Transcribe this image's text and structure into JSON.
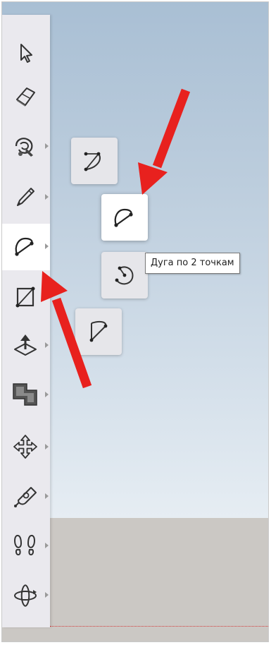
{
  "tooltip": {
    "text": "Дуга по 2 точкам"
  },
  "toolbar": {
    "tools": [
      {
        "name": "select-tool",
        "icon": "arrow-cursor-icon",
        "has_submenu": false
      },
      {
        "name": "eraser-tool",
        "icon": "eraser-icon",
        "has_submenu": false
      },
      {
        "name": "paint-bucket-tool",
        "icon": "paint-bucket-icon",
        "has_submenu": true
      },
      {
        "name": "line-tool",
        "icon": "pencil-icon",
        "has_submenu": true
      },
      {
        "name": "arc-tool",
        "icon": "arc-icon",
        "has_submenu": true,
        "active": true
      },
      {
        "name": "rectangle-tool",
        "icon": "rectangle-icon",
        "has_submenu": true
      },
      {
        "name": "push-pull-tool",
        "icon": "push-pull-icon",
        "has_submenu": true
      },
      {
        "name": "offset-tool",
        "icon": "offset-icon",
        "has_submenu": true
      },
      {
        "name": "move-tool",
        "icon": "move-arrows-icon",
        "has_submenu": true
      },
      {
        "name": "tape-measure-tool",
        "icon": "tape-measure-icon",
        "has_submenu": true
      },
      {
        "name": "walk-tool",
        "icon": "footprints-icon",
        "has_submenu": true
      },
      {
        "name": "orbit-tool",
        "icon": "orbit-icon",
        "has_submenu": true
      }
    ]
  },
  "arc_flyout": {
    "items": [
      {
        "name": "arc-center-icon",
        "hover": false
      },
      {
        "name": "arc-2-point-icon",
        "hover": true
      },
      {
        "name": "arc-3-point-icon",
        "hover": false
      },
      {
        "name": "pie-icon",
        "hover": false
      }
    ]
  },
  "colors": {
    "toolbar_bg": "#eae9ee",
    "sky_top": "#a9bfd4",
    "ground": "#cbc8c4",
    "annotation_arrow": "#e8211e"
  }
}
